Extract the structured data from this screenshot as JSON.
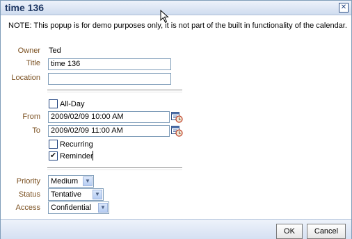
{
  "dialog": {
    "title": "time 136",
    "close_label": "✕",
    "note": "NOTE: This popup is for demo purposes only, it is not part of the built in functionality of the calendar."
  },
  "form": {
    "owner_label": "Owner",
    "owner_value": "Ted",
    "title_label": "Title",
    "title_value": "time 136",
    "location_label": "Location",
    "location_value": "",
    "allday_label": "All-Day",
    "allday_checked": false,
    "from_label": "From",
    "from_value": "2009/02/09 10:00 AM",
    "to_label": "To",
    "to_value": "2009/02/09 11:00 AM",
    "recurring_label": "Recurring",
    "recurring_checked": false,
    "reminder_label": "Reminder",
    "reminder_checked": true,
    "priority_label": "Priority",
    "priority_value": "Medium",
    "status_label": "Status",
    "status_value": "Tentative",
    "access_label": "Access",
    "access_value": "Confidential"
  },
  "footer": {
    "ok_label": "OK",
    "cancel_label": "Cancel"
  },
  "colors": {
    "label_brown": "#7a4f1f",
    "title_blue": "#1f3864",
    "border_blue": "#7f9db9"
  },
  "icons": {
    "close": "close-icon",
    "date_picker": "calendar-clock-icon",
    "dropdown": "chevron-down-icon",
    "pointer": "mouse-cursor-icon"
  }
}
